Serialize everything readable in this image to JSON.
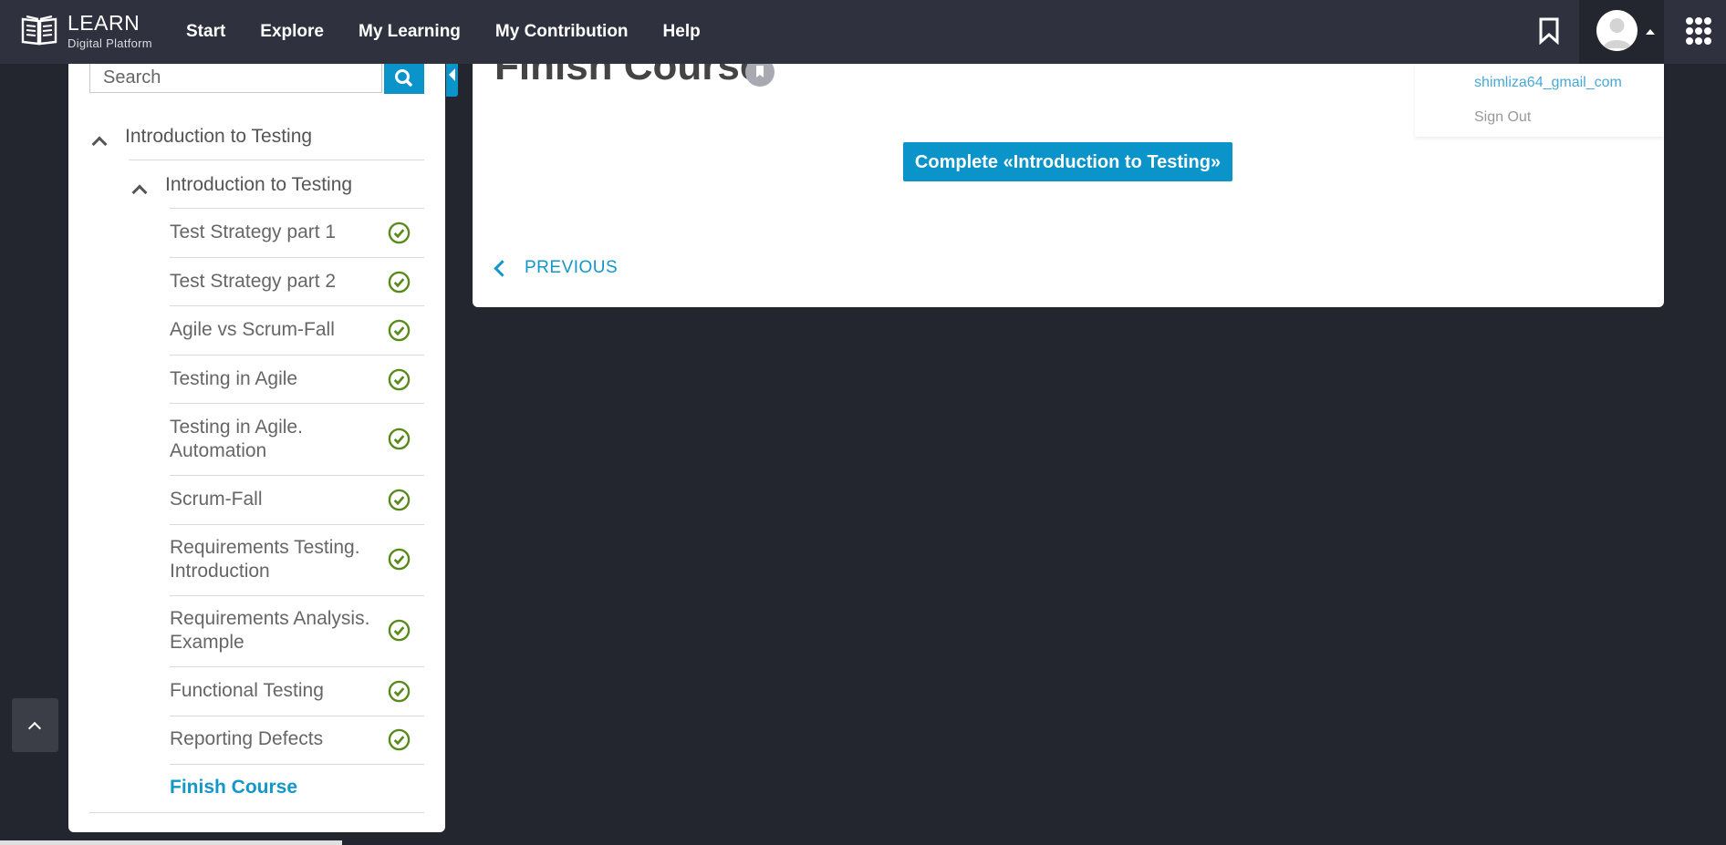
{
  "app": {
    "logo_title": "LEARN",
    "logo_subtitle": "Digital Platform"
  },
  "nav": {
    "items": [
      "Start",
      "Explore",
      "My Learning",
      "My Contribution",
      "Help"
    ]
  },
  "colors": {
    "accent": "#0a94c9",
    "check": "#5a8a1e",
    "topbar": "#2f323e",
    "background": "#23252f"
  },
  "search": {
    "placeholder": "Search"
  },
  "sidebar": {
    "section_title": "Introduction to Testing",
    "module_title": "Introduction to Testing",
    "lessons": [
      {
        "label": "Test Strategy part 1",
        "completed": true
      },
      {
        "label": "Test Strategy part 2",
        "completed": true
      },
      {
        "label": "Agile vs Scrum-Fall",
        "completed": true
      },
      {
        "label": "Testing in Agile",
        "completed": true
      },
      {
        "label": "Testing in Agile. Automation",
        "completed": true
      },
      {
        "label": "Scrum-Fall",
        "completed": true
      },
      {
        "label": "Requirements Testing. Introduction",
        "completed": true
      },
      {
        "label": "Requirements Analysis. Example",
        "completed": true
      },
      {
        "label": "Functional Testing",
        "completed": true
      },
      {
        "label": "Reporting Defects",
        "completed": true
      },
      {
        "label": "Finish Course",
        "completed": false,
        "active": true
      }
    ]
  },
  "main": {
    "title": "Finish Course",
    "complete_button": "Complete  «Introduction to Testing»",
    "previous_link": "PREVIOUS"
  },
  "user_menu": {
    "email": "shimliza64_gmail_com",
    "sign_out": "Sign Out"
  },
  "icons": [
    "book-logo-icon",
    "search-icon",
    "bookmark-icon",
    "user-avatar-icon",
    "caret-up-icon",
    "apps-grid-icon",
    "chevron-up-icon",
    "check-circle-icon",
    "chevron-left-icon"
  ]
}
